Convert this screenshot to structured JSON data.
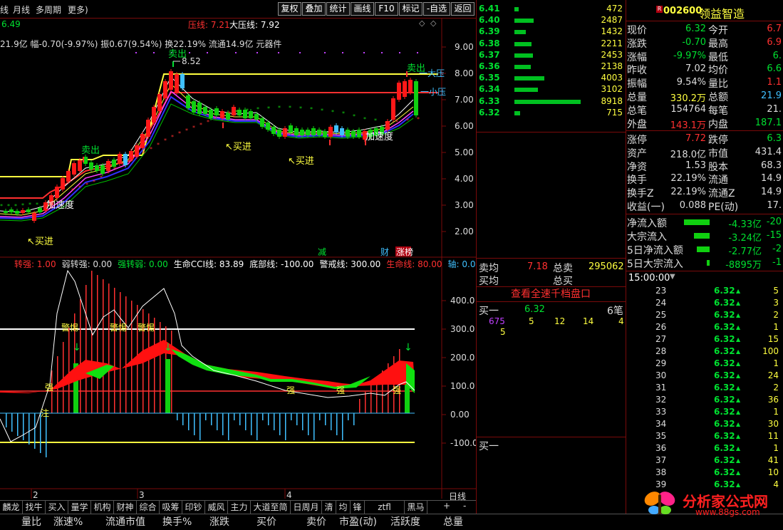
{
  "menu": [
    "线",
    "月线",
    "多周期",
    "更多)"
  ],
  "toolbar": [
    "复权",
    "叠加",
    "统计",
    "画线",
    "F10",
    "标记",
    "-自选",
    "返回"
  ],
  "main": {
    "price_prefix": "6.49",
    "pressure_label": "压线: 7.21",
    "big_pressure_label": "大压线: 7.92",
    "info_line": "21.9亿 幅-0.70(-9.97%) 振0.67(9.54%) 换22.19% 流通14.9亿 元器件",
    "y_ticks": [
      "9.00",
      "8.00",
      "7.00",
      "6.00",
      "5.00",
      "4.00",
      "3.00",
      "2.00"
    ],
    "high_label": "8.52",
    "annotations": [
      "卖出",
      "卖出",
      "加速度",
      "加速度",
      "买进",
      "买进",
      "买进",
      "大压",
      "小压"
    ],
    "badges": [
      "减",
      "财",
      "涨榜"
    ]
  },
  "indicator": {
    "legend": [
      {
        "text": "转强: 1.00",
        "color": "#ff3030"
      },
      {
        "text": "弱转强: 0.00",
        "color": "#dcdcdc"
      },
      {
        "text": "强转弱: 0.00",
        "color": "#00e030"
      },
      {
        "text": "生命CCI线: 83.89",
        "color": "#ffffff"
      },
      {
        "text": "底部线: -100.00",
        "color": "#ffffff"
      },
      {
        "text": "警戒线: 300.00",
        "color": "#ffffff"
      },
      {
        "text": "生命线: 80.00",
        "color": "#ff3030"
      },
      {
        "text": "轴: 0.0",
        "color": "#40c0ff"
      }
    ],
    "y_ticks": [
      "400.0",
      "300.0",
      "200.0",
      "100.0",
      "0.00",
      "-100.0"
    ],
    "labels": [
      "警惕",
      "警惕",
      "警惕",
      "强",
      "强",
      "强",
      "强",
      "注"
    ]
  },
  "xaxis": [
    "2",
    "3",
    "4"
  ],
  "period_label": "日线",
  "depth": [
    {
      "price": "6.41",
      "vol": "472",
      "bar": 6
    },
    {
      "price": "6.40",
      "vol": "2487",
      "bar": 27
    },
    {
      "price": "6.39",
      "vol": "1432",
      "bar": 16
    },
    {
      "price": "6.38",
      "vol": "2211",
      "bar": 24
    },
    {
      "price": "6.37",
      "vol": "2453",
      "bar": 26
    },
    {
      "price": "6.36",
      "vol": "2138",
      "bar": 23
    },
    {
      "price": "6.35",
      "vol": "4003",
      "bar": 42
    },
    {
      "price": "6.34",
      "vol": "3102",
      "bar": 33
    },
    {
      "price": "6.33",
      "vol": "8918",
      "bar": 93
    },
    {
      "price": "6.32",
      "vol": "715",
      "bar": 8
    }
  ],
  "order": {
    "sell_avg_label": "卖均",
    "sell_avg": "7.18",
    "total_sell_label": "总卖",
    "total_sell": "295062",
    "buy_avg_label": "买均",
    "total_buy_label": "总买",
    "view_all": "查看全速千档盘口",
    "bid1_label": "买一",
    "bid1_price": "6.32",
    "bid1_count": "6笔",
    "queue": [
      "675",
      "5",
      "12",
      "14",
      "4",
      "5"
    ],
    "buy1": "买一"
  },
  "stock": {
    "code": "002600",
    "name": "领益智造",
    "mark": "R"
  },
  "quote": [
    [
      "现价",
      "6.32",
      "#00e030",
      "今开",
      "6.7",
      "#ff3030"
    ],
    [
      "涨跌",
      "-0.70",
      "#00e030",
      "最高",
      "6.9",
      "#ff3030"
    ],
    [
      "涨幅",
      "-9.97%",
      "#00e030",
      "最低",
      "6.",
      "#00e030"
    ],
    [
      "昨收",
      "7.02",
      "#dcdcdc",
      "均价",
      "6.6",
      "#00e030"
    ],
    [
      "振幅",
      "9.54%",
      "#dcdcdc",
      "量比",
      "1.1",
      "#ff3030"
    ],
    [
      "总量",
      "330.2万",
      "#ffff40",
      "总额",
      "21.9",
      "#40c0ff"
    ],
    [
      "总笔",
      "154764",
      "#dcdcdc",
      "每笔",
      "21.",
      "#dcdcdc"
    ],
    [
      "外盘",
      "143.1万",
      "#ff3030",
      "内盘",
      "187.1",
      "#00e030"
    ]
  ],
  "quote2": [
    [
      "涨停",
      "7.72",
      "#ff3030",
      "跌停",
      "6.3",
      "#00e030"
    ],
    [
      "资产",
      "218.0亿",
      "#dcdcdc",
      "市值",
      "431.4",
      "#dcdcdc"
    ],
    [
      "净资",
      "1.53",
      "#dcdcdc",
      "股本",
      "68.3",
      "#dcdcdc"
    ],
    [
      "换手",
      "22.19%",
      "#dcdcdc",
      "流通",
      "14.9",
      "#dcdcdc"
    ],
    [
      "换手Z",
      "22.19%",
      "#dcdcdc",
      "流通Z",
      "14.9",
      "#dcdcdc"
    ],
    [
      "收益(一)",
      "0.088",
      "#dcdcdc",
      "PE(动)",
      "17.",
      "#dcdcdc"
    ]
  ],
  "flows": [
    [
      "净流入额",
      "-4.33亿",
      "-20",
      36
    ],
    [
      "大宗流入",
      "-3.24亿",
      "-15",
      22
    ],
    [
      "5日净流入额",
      "-2.77亿",
      "-2",
      18
    ],
    [
      "5日大宗流入",
      "-8895万",
      "-1",
      4
    ]
  ],
  "ticks_header": "15:00:00",
  "ticks": [
    [
      "23",
      "6.32",
      "5"
    ],
    [
      "24",
      "6.32",
      "3"
    ],
    [
      "25",
      "6.32",
      "2"
    ],
    [
      "26",
      "6.32",
      "1"
    ],
    [
      "27",
      "6.32",
      "15"
    ],
    [
      "28",
      "6.32",
      "100"
    ],
    [
      "29",
      "6.32",
      "1"
    ],
    [
      "30",
      "6.32",
      "24"
    ],
    [
      "31",
      "6.32",
      "2"
    ],
    [
      "32",
      "6.32",
      "36"
    ],
    [
      "33",
      "6.32",
      "1"
    ],
    [
      "34",
      "6.32",
      "30"
    ],
    [
      "35",
      "6.32",
      "11"
    ],
    [
      "36",
      "6.32",
      "1"
    ],
    [
      "37",
      "6.32",
      "41"
    ],
    [
      "38",
      "6.32",
      "10"
    ],
    [
      "39",
      "6.32",
      "4"
    ]
  ],
  "bottom_tabs": [
    "麟龙",
    "找牛",
    "买入",
    "量学",
    "机构",
    "财神",
    "综合",
    "吸筹",
    "印钞",
    "威风",
    "主力",
    "大道至简",
    "日周月",
    "清",
    "均",
    "锋",
    "ztfl",
    "黑马"
  ],
  "columns": [
    "量比",
    "涨速%",
    "流通市值",
    "换手%",
    "涨跌",
    "买价",
    "卖价",
    "市盈(动)",
    "活跃度",
    "总量"
  ],
  "watermark": "分析家公式网",
  "watermark_url": "www.88gs.com"
}
